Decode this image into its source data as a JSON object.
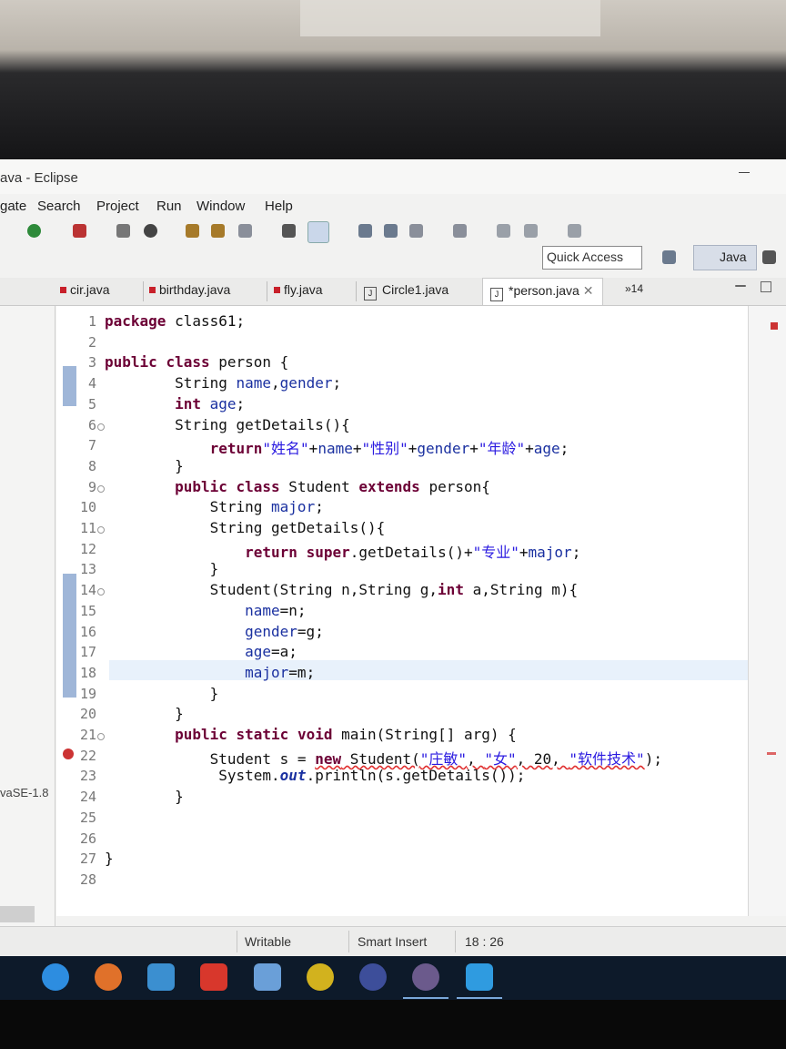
{
  "window": {
    "title": "ava - Eclipse"
  },
  "menu": [
    "gate",
    "Search",
    "Project",
    "Run",
    "Window",
    "Help"
  ],
  "toolbar": {
    "quick_access": "Quick Access",
    "perspective": "Java"
  },
  "tabs": [
    {
      "label": "cir.java"
    },
    {
      "label": "birthday.java"
    },
    {
      "label": "fly.java"
    },
    {
      "label": "Circle1.java"
    },
    {
      "label": "*person.java",
      "active": true
    }
  ],
  "overflow_tabs": "»14",
  "left_panel": {
    "jre_label": "vaSE-1.8"
  },
  "code_lines": [
    "package class61;",
    "",
    "public class person {",
    "        String name,gender;",
    "        int age;",
    "        String getDetails(){",
    "            return\"姓名\"+name+\"性别\"+gender+\"年龄\"+age;",
    "        }",
    "        public class Student extends person{",
    "            String major;",
    "            String getDetails(){",
    "                return super.getDetails()+\"专业\"+major;",
    "            }",
    "            Student(String n,String g,int a,String m){",
    "                name=n;",
    "                gender=g;",
    "                age=a;",
    "                major=m;",
    "            }",
    "        }",
    "        public static void main(String[] arg) {",
    "            Student s = new Student(\"庄敏\", \"女\", 20, \"软件技术\");",
    "             System.out.println(s.getDetails());",
    "        }",
    "",
    "",
    "}",
    ""
  ],
  "status": {
    "mode": "Writable",
    "insert": "Smart Insert",
    "position": "18 : 26"
  },
  "colors": {
    "keyword": "#6c0035",
    "field": "#1a30a0",
    "string": "#2a1ae0",
    "change_bar": "#9fb6d8",
    "current_line": "#e8f1fb"
  },
  "taskbar_icons": [
    "edge-icon",
    "firefox-icon",
    "network-icon",
    "netease-music-icon",
    "notepad-icon",
    "ball-icon",
    "browser-icon",
    "eclipse-icon",
    "writer-icon"
  ]
}
